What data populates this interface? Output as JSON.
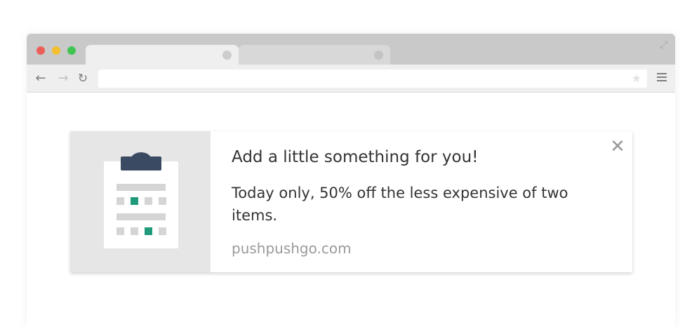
{
  "browser": {
    "icons": {
      "close_window": "red-dot",
      "minimize_window": "yellow-dot",
      "maximize_window": "green-dot",
      "back": "arrow-left-icon",
      "forward": "arrow-right-icon",
      "reload": "reload-icon",
      "bookmark": "star-icon",
      "menu": "hamburger-icon",
      "fullscreen": "expand-icon"
    },
    "url": "",
    "colors": {
      "chrome_bg": "#c9c9c9",
      "toolbar_bg": "#efefef"
    }
  },
  "notification": {
    "title": "Add a little something for you!",
    "body": "Today only, 50% off the less expensive of two items.",
    "site": "pushpushgo.com",
    "close_symbol": "✕",
    "icon": "clipboard-icon",
    "colors": {
      "accent": "#1f9a7a",
      "clip": "#3a4a62",
      "panel": "#e6e6e6"
    }
  }
}
